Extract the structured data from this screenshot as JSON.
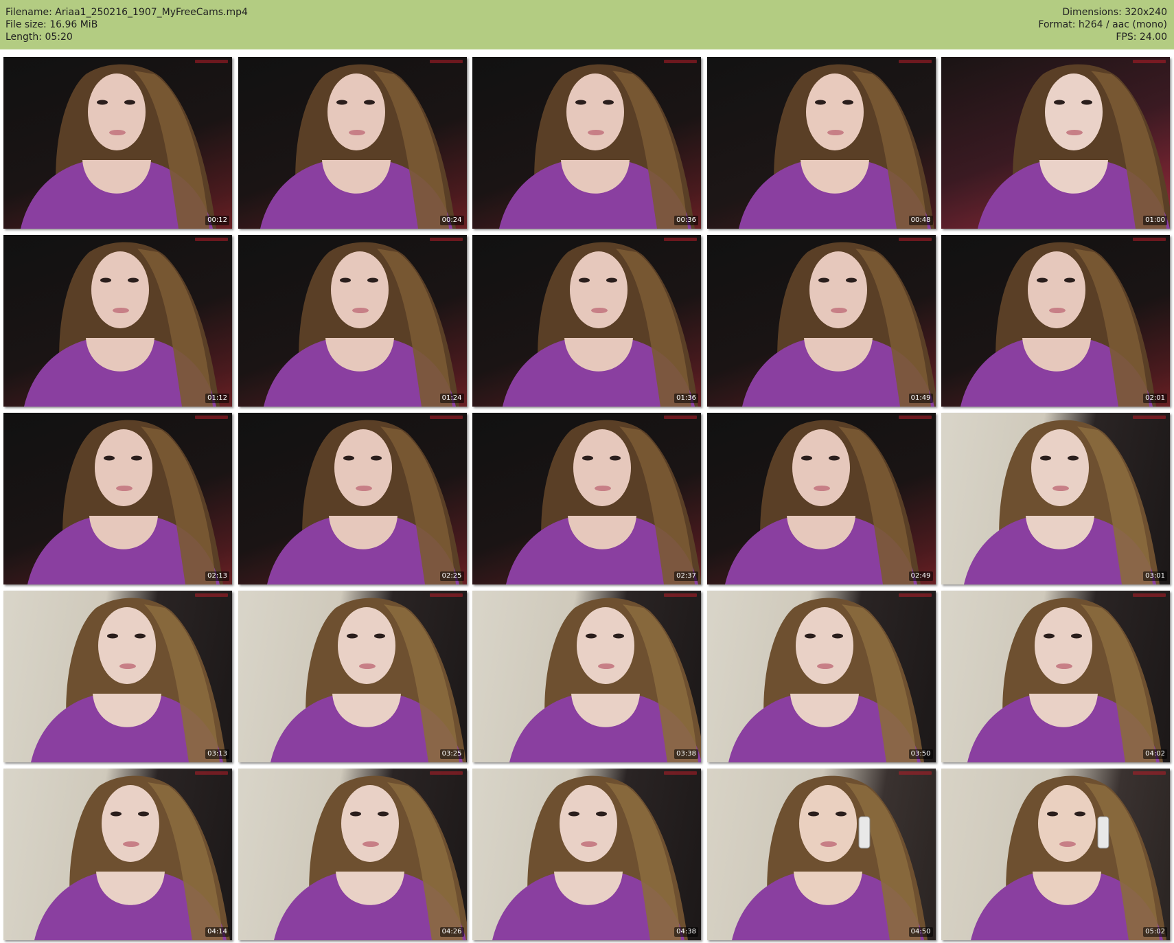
{
  "header": {
    "filename_label": "Filename: Ariaa1_250216_1907_MyFreeCams.mp4",
    "filesize_label": "File size: 16.96 MiB",
    "length_label": "Length: 05:20",
    "dimensions_label": "Dimensions: 320x240",
    "format_label": "Format: h264 / aac (mono)",
    "fps_label": "FPS: 24.00"
  },
  "colors": {
    "header_bg": "#b3cc82",
    "sweater": "#8a3fa0",
    "hair": "#6b4a2a"
  },
  "thumbnails": [
    {
      "timestamp": "00:12",
      "scene": "dark"
    },
    {
      "timestamp": "00:24",
      "scene": "dark"
    },
    {
      "timestamp": "00:36",
      "scene": "dark"
    },
    {
      "timestamp": "00:48",
      "scene": "dark-arm"
    },
    {
      "timestamp": "01:00",
      "scene": "close"
    },
    {
      "timestamp": "01:12",
      "scene": "dark"
    },
    {
      "timestamp": "01:24",
      "scene": "dark"
    },
    {
      "timestamp": "01:36",
      "scene": "dark"
    },
    {
      "timestamp": "01:49",
      "scene": "dark"
    },
    {
      "timestamp": "02:01",
      "scene": "dark"
    },
    {
      "timestamp": "02:13",
      "scene": "dark"
    },
    {
      "timestamp": "02:25",
      "scene": "dark"
    },
    {
      "timestamp": "02:37",
      "scene": "dark"
    },
    {
      "timestamp": "02:49",
      "scene": "dark"
    },
    {
      "timestamp": "03:01",
      "scene": "light"
    },
    {
      "timestamp": "03:13",
      "scene": "light"
    },
    {
      "timestamp": "03:25",
      "scene": "light"
    },
    {
      "timestamp": "03:38",
      "scene": "light"
    },
    {
      "timestamp": "03:50",
      "scene": "light"
    },
    {
      "timestamp": "04:02",
      "scene": "light"
    },
    {
      "timestamp": "04:14",
      "scene": "light"
    },
    {
      "timestamp": "04:26",
      "scene": "light"
    },
    {
      "timestamp": "04:38",
      "scene": "light"
    },
    {
      "timestamp": "04:50",
      "scene": "light-phone"
    },
    {
      "timestamp": "05:02",
      "scene": "light-phone"
    }
  ]
}
